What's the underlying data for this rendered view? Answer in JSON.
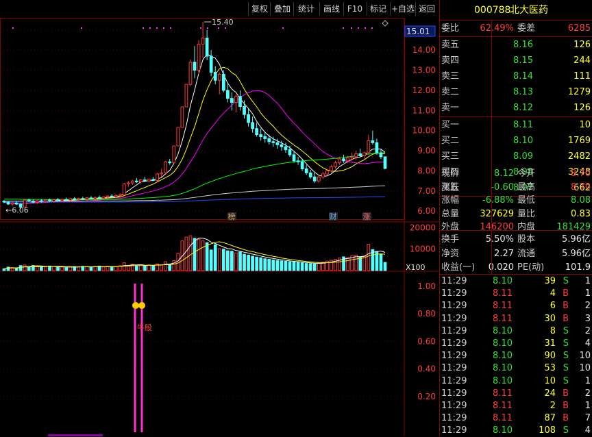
{
  "toolbar": {
    "buttons": [
      "复权",
      "叠加",
      "统计",
      "画线",
      "F10",
      "标记",
      "+自选",
      "返回"
    ]
  },
  "stock": {
    "code": "000788",
    "name": "北大医药"
  },
  "order_ratio": {
    "label": "委比",
    "value": "62.49%",
    "diff_label": "委差",
    "diff_value": "6285"
  },
  "sells": [
    {
      "label": "卖五",
      "price": "8.16",
      "volume": "126"
    },
    {
      "label": "卖四",
      "price": "8.15",
      "volume": "244"
    },
    {
      "label": "卖三",
      "price": "8.14",
      "volume": "111"
    },
    {
      "label": "卖二",
      "price": "8.13",
      "volume": "1279"
    },
    {
      "label": "卖一",
      "price": "8.12",
      "volume": "126"
    }
  ],
  "buys": [
    {
      "label": "买一",
      "price": "8.11",
      "volume": "10"
    },
    {
      "label": "买二",
      "price": "8.10",
      "volume": "1769"
    },
    {
      "label": "买三",
      "price": "8.09",
      "volume": "2482"
    },
    {
      "label": "买四",
      "price": "8.08",
      "volume": "3248"
    },
    {
      "label": "买五",
      "price": "8.07",
      "volume": "662"
    }
  ],
  "quote": [
    {
      "l1": "现价",
      "v1": "8.12",
      "c1": "g",
      "l2": "今开",
      "v2": "8.70",
      "c2": "r"
    },
    {
      "l1": "涨跌",
      "v1": "-0.60",
      "c1": "g",
      "l2": "最高",
      "v2": "8.70",
      "c2": "r"
    },
    {
      "l1": "涨幅",
      "v1": "-6.88%",
      "c1": "g",
      "l2": "最低",
      "v2": "8.08",
      "c2": "g"
    },
    {
      "l1": "总量",
      "v1": "327629",
      "c1": "y",
      "l2": "量比",
      "v2": "0.83",
      "c2": "y"
    },
    {
      "l1": "外盘",
      "v1": "146200",
      "c1": "r",
      "l2": "内盘",
      "v2": "181429",
      "c2": "g"
    }
  ],
  "fundamentals": [
    {
      "l1": "换手",
      "v1": "5.50%",
      "l2": "股本",
      "v2": "5.96亿"
    },
    {
      "l1": "净资",
      "v1": "2.27",
      "l2": "流通",
      "v2": "5.96亿"
    },
    {
      "l1": "收益(一)",
      "v1": "0.020",
      "l2": "PE(动)",
      "v2": "101.9"
    }
  ],
  "ticks": [
    {
      "time": "11:29",
      "price": "8.10",
      "vol": "39",
      "side": "S",
      "n": "1"
    },
    {
      "time": "11:29",
      "price": "8.11",
      "vol": "4",
      "side": "B",
      "n": "1"
    },
    {
      "time": "11:29",
      "price": "8.11",
      "vol": "6",
      "side": "B",
      "n": "2"
    },
    {
      "time": "11:29",
      "price": "8.11",
      "vol": "30",
      "side": "B",
      "n": "3"
    },
    {
      "time": "11:29",
      "price": "8.10",
      "vol": "8",
      "side": "S",
      "n": "2"
    },
    {
      "time": "11:29",
      "price": "8.10",
      "vol": "31",
      "side": "S",
      "n": "4"
    },
    {
      "time": "11:29",
      "price": "8.10",
      "vol": "90",
      "side": "S",
      "n": "10"
    },
    {
      "time": "11:29",
      "price": "8.10",
      "vol": "53",
      "side": "S",
      "n": "10"
    },
    {
      "time": "11:29",
      "price": "8.10",
      "vol": "10",
      "side": "S",
      "n": "1"
    },
    {
      "time": "11:29",
      "price": "8.11",
      "vol": "24",
      "side": "B",
      "n": "2"
    },
    {
      "time": "11:29",
      "price": "8.11",
      "vol": "2",
      "side": "B",
      "n": "1"
    },
    {
      "time": "11:29",
      "price": "8.11",
      "vol": "87",
      "side": "B",
      "n": "7"
    },
    {
      "time": "11:29",
      "price": "8.10",
      "vol": "108",
      "side": "S",
      "n": "4"
    }
  ],
  "chart_data": {
    "type": "candlestick",
    "price_axis": [
      "15.00",
      "14.00",
      "13.00",
      "12.00",
      "11.00",
      "10.00",
      "9.00",
      "8.00",
      "7.00",
      "6.00"
    ],
    "current_price_label": "15.01",
    "high_marker": "15.40",
    "low_marker": "6.06",
    "event_markers": [
      "榜",
      "财",
      "涨"
    ],
    "volume_axis": [
      "20000",
      "10000"
    ],
    "volume_unit": "X100",
    "indicator_axis": [
      "1.00",
      "0.80",
      "0.60",
      "0.40",
      "0.20"
    ],
    "indicator_label": "牛股",
    "candles": [
      [
        6.5,
        6.55,
        6.4,
        6.45
      ],
      [
        6.45,
        6.5,
        6.3,
        6.35
      ],
      [
        6.35,
        6.45,
        6.25,
        6.4
      ],
      [
        6.4,
        6.5,
        6.3,
        6.35
      ],
      [
        6.35,
        6.4,
        6.1,
        6.2
      ],
      [
        6.2,
        6.6,
        6.18,
        6.55
      ],
      [
        6.55,
        6.62,
        6.45,
        6.5
      ],
      [
        6.5,
        6.58,
        6.4,
        6.45
      ],
      [
        6.45,
        6.55,
        6.35,
        6.52
      ],
      [
        6.52,
        6.6,
        6.42,
        6.48
      ],
      [
        6.48,
        6.58,
        6.4,
        6.55
      ],
      [
        6.55,
        6.62,
        6.45,
        6.5
      ],
      [
        6.5,
        6.6,
        6.42,
        6.57
      ],
      [
        6.57,
        6.65,
        6.48,
        6.52
      ],
      [
        6.52,
        6.62,
        6.45,
        6.58
      ],
      [
        6.58,
        6.68,
        6.5,
        6.55
      ],
      [
        6.55,
        6.65,
        6.48,
        6.62
      ],
      [
        6.62,
        6.7,
        6.52,
        6.58
      ],
      [
        6.58,
        6.68,
        6.5,
        6.63
      ],
      [
        6.63,
        6.72,
        6.55,
        6.6
      ],
      [
        6.6,
        6.7,
        6.52,
        6.66
      ],
      [
        6.66,
        6.75,
        6.58,
        6.62
      ],
      [
        6.62,
        6.72,
        6.55,
        6.68
      ],
      [
        6.68,
        6.78,
        6.6,
        6.64
      ],
      [
        6.64,
        6.74,
        6.58,
        6.7
      ],
      [
        6.7,
        6.8,
        6.62,
        6.75
      ],
      [
        6.75,
        6.85,
        6.65,
        6.72
      ],
      [
        6.72,
        6.82,
        6.66,
        6.78
      ],
      [
        6.78,
        6.88,
        6.7,
        6.8
      ],
      [
        6.8,
        7.4,
        6.78,
        7.35
      ],
      [
        7.35,
        7.5,
        7.2,
        7.4
      ],
      [
        7.4,
        7.55,
        7.3,
        7.5
      ],
      [
        7.5,
        7.65,
        7.4,
        7.45
      ],
      [
        7.45,
        7.6,
        7.38,
        7.55
      ],
      [
        7.55,
        7.7,
        7.45,
        7.5
      ],
      [
        7.5,
        7.62,
        7.42,
        7.58
      ],
      [
        7.58,
        7.7,
        7.5,
        7.52
      ],
      [
        7.52,
        7.9,
        7.48,
        7.85
      ],
      [
        7.85,
        8.1,
        7.7,
        7.9
      ],
      [
        7.9,
        8.5,
        7.85,
        8.45
      ],
      [
        8.45,
        8.6,
        8.3,
        8.4
      ],
      [
        8.4,
        9.24,
        8.38,
        9.24
      ],
      [
        9.24,
        10.16,
        9.24,
        10.16
      ],
      [
        10.16,
        11.18,
        10.16,
        11.18
      ],
      [
        11.18,
        12.3,
        11.18,
        12.3
      ],
      [
        12.3,
        13.53,
        12.2,
        13.4
      ],
      [
        13.4,
        14.2,
        12.6,
        13.0
      ],
      [
        13.0,
        14.5,
        12.8,
        14.3
      ],
      [
        14.3,
        15.4,
        13.6,
        14.6
      ],
      [
        14.6,
        15.0,
        13.5,
        13.7
      ],
      [
        13.7,
        14.0,
        12.7,
        12.9
      ],
      [
        12.9,
        13.2,
        12.3,
        12.5
      ],
      [
        12.5,
        12.9,
        11.8,
        12.8
      ],
      [
        12.8,
        13.0,
        11.9,
        12.0
      ],
      [
        12.0,
        12.4,
        11.4,
        11.6
      ],
      [
        11.6,
        11.9,
        11.0,
        11.4
      ],
      [
        11.4,
        11.8,
        10.9,
        11.7
      ],
      [
        11.7,
        12.0,
        11.0,
        11.2
      ],
      [
        11.2,
        11.5,
        10.6,
        10.8
      ],
      [
        10.8,
        11.1,
        10.2,
        10.4
      ],
      [
        10.4,
        10.7,
        9.9,
        10.1
      ],
      [
        10.1,
        10.4,
        9.7,
        9.8
      ],
      [
        9.8,
        10.1,
        9.5,
        9.7
      ],
      [
        9.7,
        9.9,
        9.4,
        9.6
      ],
      [
        9.6,
        9.8,
        9.3,
        9.45
      ],
      [
        9.45,
        9.7,
        9.2,
        9.4
      ],
      [
        9.4,
        9.6,
        9.1,
        9.3
      ],
      [
        9.3,
        9.5,
        9.0,
        9.2
      ],
      [
        9.2,
        9.4,
        8.9,
        9.05
      ],
      [
        9.05,
        9.25,
        8.7,
        8.8
      ],
      [
        8.8,
        9.0,
        8.4,
        8.5
      ],
      [
        8.5,
        8.7,
        8.3,
        8.45
      ],
      [
        8.45,
        8.6,
        8.0,
        8.1
      ],
      [
        8.1,
        8.3,
        7.8,
        7.9
      ],
      [
        7.9,
        8.05,
        7.6,
        7.7
      ],
      [
        7.7,
        7.9,
        7.4,
        7.5
      ],
      [
        7.5,
        7.8,
        7.4,
        7.7
      ],
      [
        7.7,
        7.95,
        7.6,
        7.85
      ],
      [
        7.85,
        8.1,
        7.75,
        8.0
      ],
      [
        8.0,
        8.3,
        7.9,
        8.2
      ],
      [
        8.2,
        8.5,
        8.1,
        8.4
      ],
      [
        8.4,
        8.7,
        8.3,
        8.6
      ],
      [
        8.6,
        8.8,
        8.4,
        8.5
      ],
      [
        8.5,
        8.75,
        8.4,
        8.65
      ],
      [
        8.65,
        8.9,
        8.5,
        8.7
      ],
      [
        8.7,
        9.0,
        8.55,
        8.85
      ],
      [
        8.85,
        9.1,
        8.7,
        8.75
      ],
      [
        8.75,
        8.95,
        8.6,
        8.9
      ],
      [
        8.9,
        9.8,
        8.8,
        9.5
      ],
      [
        9.5,
        10.0,
        9.3,
        9.4
      ],
      [
        9.4,
        9.6,
        8.8,
        8.9
      ],
      [
        8.9,
        9.1,
        8.6,
        8.7
      ],
      [
        8.7,
        8.7,
        8.08,
        8.12
      ]
    ],
    "volumes": [
      800,
      1600,
      1400,
      1200,
      2300,
      2600,
      1900,
      2400,
      2000,
      1800,
      1700,
      2100,
      1900,
      1500,
      1600,
      1400,
      1700,
      1900,
      1700,
      2000,
      1800,
      1600,
      1900,
      2100,
      1700,
      2000,
      1900,
      1800,
      2300,
      3600,
      2400,
      2900,
      2100,
      2700,
      2200,
      2600,
      2300,
      3100,
      2600,
      4100,
      3000,
      4600,
      8000,
      13800,
      15600,
      16200,
      15000,
      14600,
      13800,
      13000,
      9600,
      12000,
      10200,
      10000,
      9200,
      9000,
      8200,
      8600,
      7600,
      7200,
      6700,
      6300,
      6000,
      5500,
      5300,
      4900,
      4700,
      4500,
      4300,
      4100,
      4000,
      3800,
      3600,
      3300,
      3200,
      3100,
      3500,
      3900,
      4400,
      4800,
      5200,
      5800,
      6400,
      6000,
      6800,
      7200,
      6200,
      6900,
      12300,
      9800,
      8900,
      7500,
      3800
    ],
    "ma_colors": [
      "#ffffff",
      "#ffff00",
      "#ff00ff",
      "#00ff00",
      "#d0d0d0",
      "#2a4bff"
    ]
  }
}
